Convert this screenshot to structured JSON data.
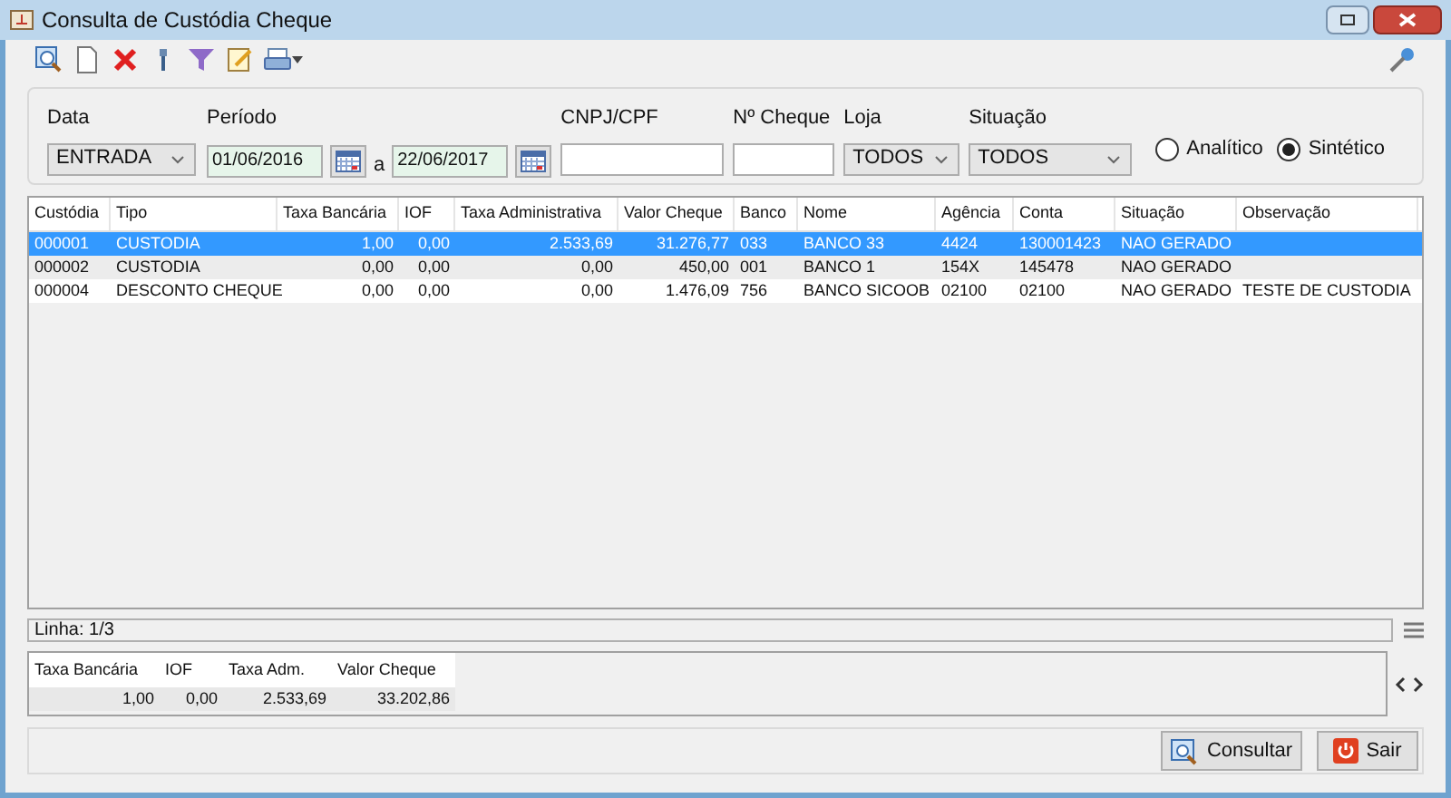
{
  "window": {
    "title": "Consulta de Custódia Cheque"
  },
  "filters": {
    "data": {
      "label": "Data",
      "value": "ENTRADA"
    },
    "periodo": {
      "label": "Período",
      "from": "01/06/2016",
      "separator": "a",
      "to": "22/06/2017"
    },
    "cnpj": {
      "label": "CNPJ/CPF"
    },
    "cheque": {
      "label": "Nº Cheque"
    },
    "loja": {
      "label": "Loja",
      "value": "TODOS"
    },
    "situacao": {
      "label": "Situação",
      "value": "TODOS"
    },
    "modes": [
      {
        "label": "Analítico",
        "selected": false
      },
      {
        "label": "Sintético",
        "selected": true
      }
    ]
  },
  "table": {
    "columns": [
      "Custódia",
      "Tipo",
      "Taxa Bancária",
      "IOF",
      "Taxa Administrativa",
      "Valor Cheque",
      "Banco",
      "Nome",
      "Agência",
      "Conta",
      "Situação",
      "Observação"
    ],
    "rows": [
      {
        "selected": true,
        "cells": [
          "000001",
          "CUSTODIA",
          "1,00",
          "0,00",
          "2.533,69",
          "31.276,77",
          "033",
          "BANCO 33",
          "4424",
          "130001423",
          "NAO GERADO",
          null
        ]
      },
      {
        "selected": false,
        "cells": [
          "000002",
          "CUSTODIA",
          "0,00",
          "0,00",
          "0,00",
          "450,00",
          "001",
          "BANCO 1",
          "154X",
          "145478",
          "NAO GERADO",
          null
        ]
      },
      {
        "selected": false,
        "cells": [
          "000004",
          "DESCONTO CHEQUE",
          "0,00",
          "0,00",
          "0,00",
          "1.476,09",
          "756",
          "BANCO SICOOB",
          "02100",
          "02100",
          "NAO GERADO",
          "TESTE DE CUSTODIA"
        ]
      }
    ]
  },
  "status_bar": {
    "text": "Linha: 1/3"
  },
  "totals": {
    "columns": [
      "Taxa Bancária",
      "IOF",
      "Taxa Adm.",
      "Valor Cheque"
    ],
    "values": [
      "1,00",
      "0,00",
      "2.533,69",
      "33.202,86"
    ]
  },
  "buttons": [
    "Consultar",
    "Sair"
  ]
}
